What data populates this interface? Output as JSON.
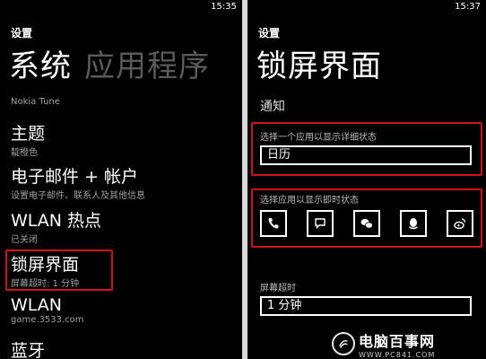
{
  "left": {
    "status_time": "15:35",
    "section": "设置",
    "pivot_active": "系统",
    "pivot_next": "应用程序",
    "nokia_tune": "Nokia Tune",
    "items": [
      {
        "title": "主题",
        "subtitle": "靛橙色"
      },
      {
        "title": "电子邮件 + 帐户",
        "subtitle": "设置电子邮件、联系人及其他信息"
      },
      {
        "title": "WLAN 热点",
        "subtitle": "已关闭"
      },
      {
        "title": "锁屏界面",
        "subtitle": "屏幕超时: 1 分钟"
      },
      {
        "title": "WLAN",
        "subtitle": "game.3533.com"
      },
      {
        "title": "蓝牙",
        "subtitle": ""
      }
    ]
  },
  "right": {
    "status_time": "15:37",
    "section": "设置",
    "title": "锁屏界面",
    "notifications_header": "通知",
    "detailed_status_label": "选择一个应用以显示详细状态",
    "detailed_status_value": "日历",
    "quick_status_label": "选择应用以显示即时状态",
    "quick_status_apps": [
      "phone-icon",
      "messaging-icon",
      "wechat-icon",
      "qq-icon",
      "weibo-icon"
    ],
    "screen_timeout_label": "屏幕超时",
    "screen_timeout_value": "1 分钟"
  },
  "watermark": {
    "name": "电脑百事网",
    "url": "WWW.PC841.COM"
  },
  "colors": {
    "highlight": "#d0101b",
    "background": "#000000",
    "divider": "#d9d9d9"
  }
}
